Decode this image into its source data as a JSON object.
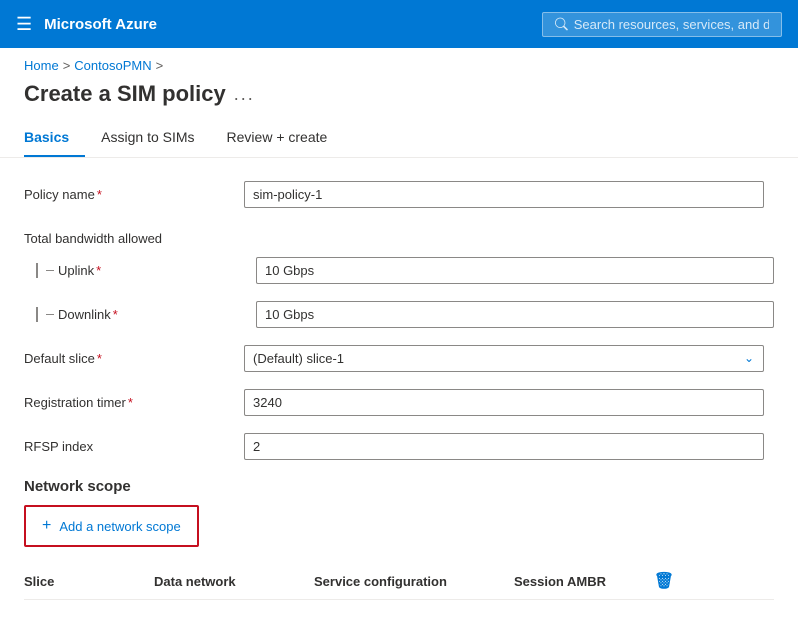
{
  "topbar": {
    "hamburger": "☰",
    "title": "Microsoft Azure",
    "search_placeholder": "Search resources, services, and docs"
  },
  "breadcrumb": {
    "home": "Home",
    "contoso": "ContosoPMN",
    "sep1": ">",
    "sep2": ">"
  },
  "page": {
    "title": "Create a SIM policy",
    "ellipsis": "..."
  },
  "tabs": [
    {
      "id": "basics",
      "label": "Basics",
      "active": true
    },
    {
      "id": "assign",
      "label": "Assign to SIMs",
      "active": false
    },
    {
      "id": "review",
      "label": "Review + create",
      "active": false
    }
  ],
  "form": {
    "policy_name_label": "Policy name",
    "policy_name_required": "*",
    "policy_name_value": "sim-policy-1",
    "bandwidth_label": "Total bandwidth allowed",
    "uplink_label": "Uplink",
    "uplink_required": "*",
    "uplink_value": "10 Gbps",
    "downlink_label": "Downlink",
    "downlink_required": "*",
    "downlink_value": "10 Gbps",
    "default_slice_label": "Default slice",
    "default_slice_required": "*",
    "default_slice_value": "(Default) slice-1",
    "registration_timer_label": "Registration timer",
    "registration_timer_required": "*",
    "registration_timer_value": "3240",
    "rfsp_index_label": "RFSP index",
    "rfsp_index_value": "2"
  },
  "network_scope": {
    "section_label": "Network scope",
    "add_button_label": "Add a network scope",
    "add_button_plus": "+"
  },
  "table": {
    "col_slice": "Slice",
    "col_data_network": "Data network",
    "col_service_config": "Service configuration",
    "col_session_ambr": "Session AMBR",
    "delete_icon": "🗑"
  }
}
